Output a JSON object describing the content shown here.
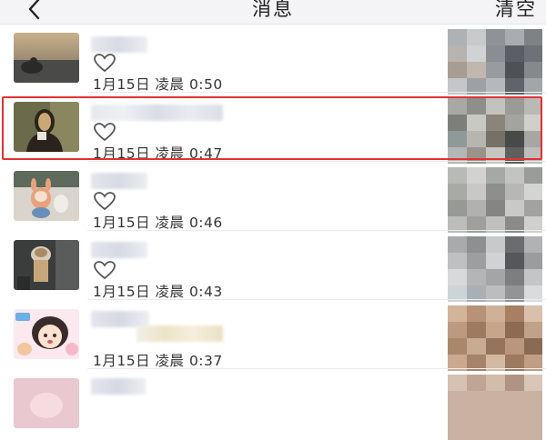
{
  "header": {
    "title": "消息",
    "clear_label": "清空",
    "back_icon": "chevron-left-icon"
  },
  "messages": [
    {
      "time": "1月15日 凌晨 0:50",
      "avatar": "seaside-photo",
      "reaction_icon": "heart-outline-icon",
      "highlighted": false
    },
    {
      "time": "1月15日 凌晨 0:47",
      "avatar": "mona-lisa-meme",
      "reaction_icon": "heart-outline-icon",
      "highlighted": true
    },
    {
      "time": "1月15日 凌晨 0:46",
      "avatar": "plush-toys",
      "reaction_icon": "heart-outline-icon",
      "highlighted": false
    },
    {
      "time": "1月15日 凌晨 0:43",
      "avatar": "cat-with-paper",
      "reaction_icon": "heart-outline-icon",
      "highlighted": false
    },
    {
      "time": "1月15日 凌晨 0:37",
      "avatar": "cartoon-girl",
      "reaction_icon": "heart-outline-icon",
      "highlighted": false
    }
  ],
  "colors": {
    "highlight_border": "#e33131",
    "header_bg": "#f4f4f6",
    "heart_stroke": "#555555"
  }
}
